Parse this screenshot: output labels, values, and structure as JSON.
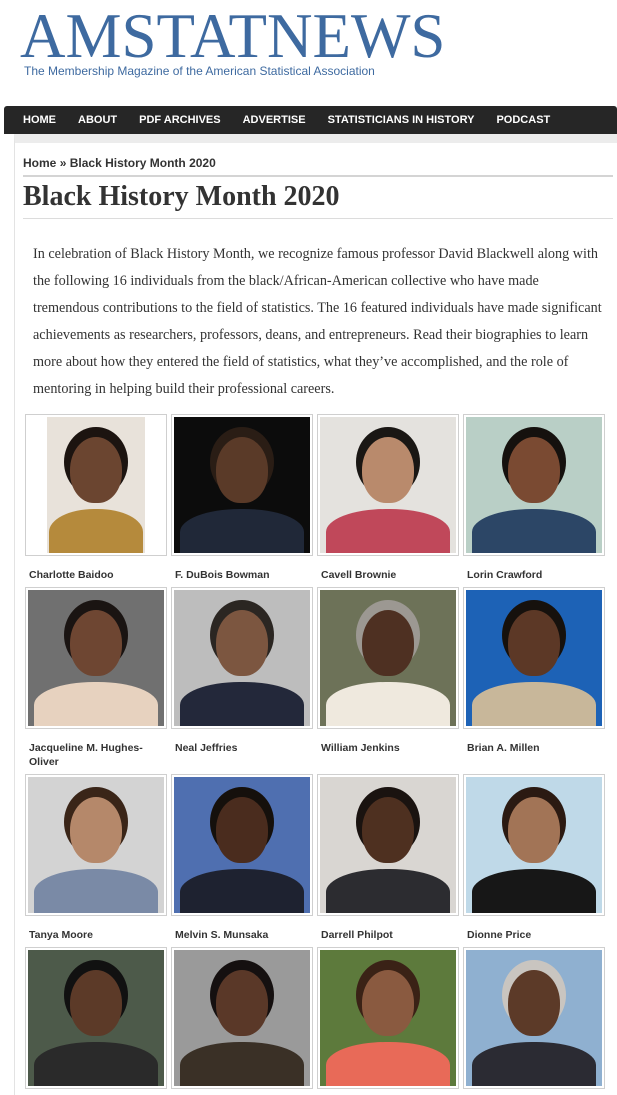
{
  "masthead": {
    "title": "AMSTATNEWS",
    "subtitle": "The Membership Magazine of the American Statistical Association"
  },
  "nav": [
    "HOME",
    "ABOUT",
    "PDF ARCHIVES",
    "ADVERTISE",
    "STATISTICIANS IN HISTORY",
    "PODCAST"
  ],
  "breadcrumb": {
    "home": "Home",
    "separator": "»",
    "current": "Black History Month 2020"
  },
  "page": {
    "title": "Black History Month 2020",
    "intro": "In celebration of Black History Month, we recognize famous professor David Blackwell along with the following 16 individuals from the black/African-American collective who have made tremendous contributions to the field of statistics. The 16 featured individuals have made significant achievements as researchers, professors, deans, and entrepreneurs. Read their biographies to learn more about how they entered the field of statistics, what they’ve accomplished, and the role of mentoring in helping build their professional careers."
  },
  "people": [
    {
      "name": "Charlotte Baidoo",
      "bg": "#e8e2da",
      "skin": "#6b4530",
      "clothes": "#b58a3c",
      "hair": "#1c1410"
    },
    {
      "name": "F. DuBois Bowman",
      "bg": "#0c0c0c",
      "skin": "#5a3a28",
      "clothes": "#202838",
      "hair": "#2a1d15"
    },
    {
      "name": "Cavell Brownie",
      "bg": "#e4e2de",
      "skin": "#b98a6c",
      "clothes": "#c0485a",
      "hair": "#1a1714"
    },
    {
      "name": "Lorin Crawford",
      "bg": "#b9cfc6",
      "skin": "#7a4a32",
      "clothes": "#2c4666",
      "hair": "#15110e"
    },
    {
      "name": "Jacqueline M. Hughes-Oliver",
      "bg": "#707070",
      "skin": "#6e4632",
      "clothes": "#e7d2bf",
      "hair": "#1a1412"
    },
    {
      "name": "Neal Jeffries",
      "bg": "#bdbdbd",
      "skin": "#7c5640",
      "clothes": "#23283a",
      "hair": "#2b2622"
    },
    {
      "name": "William Jenkins",
      "bg": "#6d7258",
      "skin": "#4e3022",
      "clothes": "#efe9de",
      "hair": "#9c9892"
    },
    {
      "name": "Brian A. Millen",
      "bg": "#1d62b6",
      "skin": "#5c3826",
      "clothes": "#c8b79a",
      "hair": "#16110d"
    },
    {
      "name": "Tanya Moore",
      "bg": "#d3d3d3",
      "skin": "#b5886a",
      "clothes": "#7a8aa6",
      "hair": "#3a2518"
    },
    {
      "name": "Melvin S. Munsaka",
      "bg": "#4f6fb0",
      "skin": "#4a2c1e",
      "clothes": "#1e2230",
      "hair": "#15100c"
    },
    {
      "name": "Darrell Philpot",
      "bg": "#d9d6d2",
      "skin": "#4e3020",
      "clothes": "#2c2c30",
      "hair": "#1a1310"
    },
    {
      "name": "Dionne Price",
      "bg": "#bfd9e8",
      "skin": "#a27456",
      "clothes": "#171717",
      "hair": "#2b1a12"
    },
    {
      "name": "",
      "bg": "#4d5a4a",
      "skin": "#5c3a28",
      "clothes": "#2a2a2a",
      "hair": "#111111"
    },
    {
      "name": "",
      "bg": "#9a9a9a",
      "skin": "#5a3828",
      "clothes": "#3a3026",
      "hair": "#151010"
    },
    {
      "name": "",
      "bg": "#5d7a3c",
      "skin": "#8a5a40",
      "clothes": "#e86a58",
      "hair": "#3a2216"
    },
    {
      "name": "",
      "bg": "#8fb0d0",
      "skin": "#5c3a28",
      "clothes": "#2b2b33",
      "hair": "#c9c5c0"
    }
  ]
}
